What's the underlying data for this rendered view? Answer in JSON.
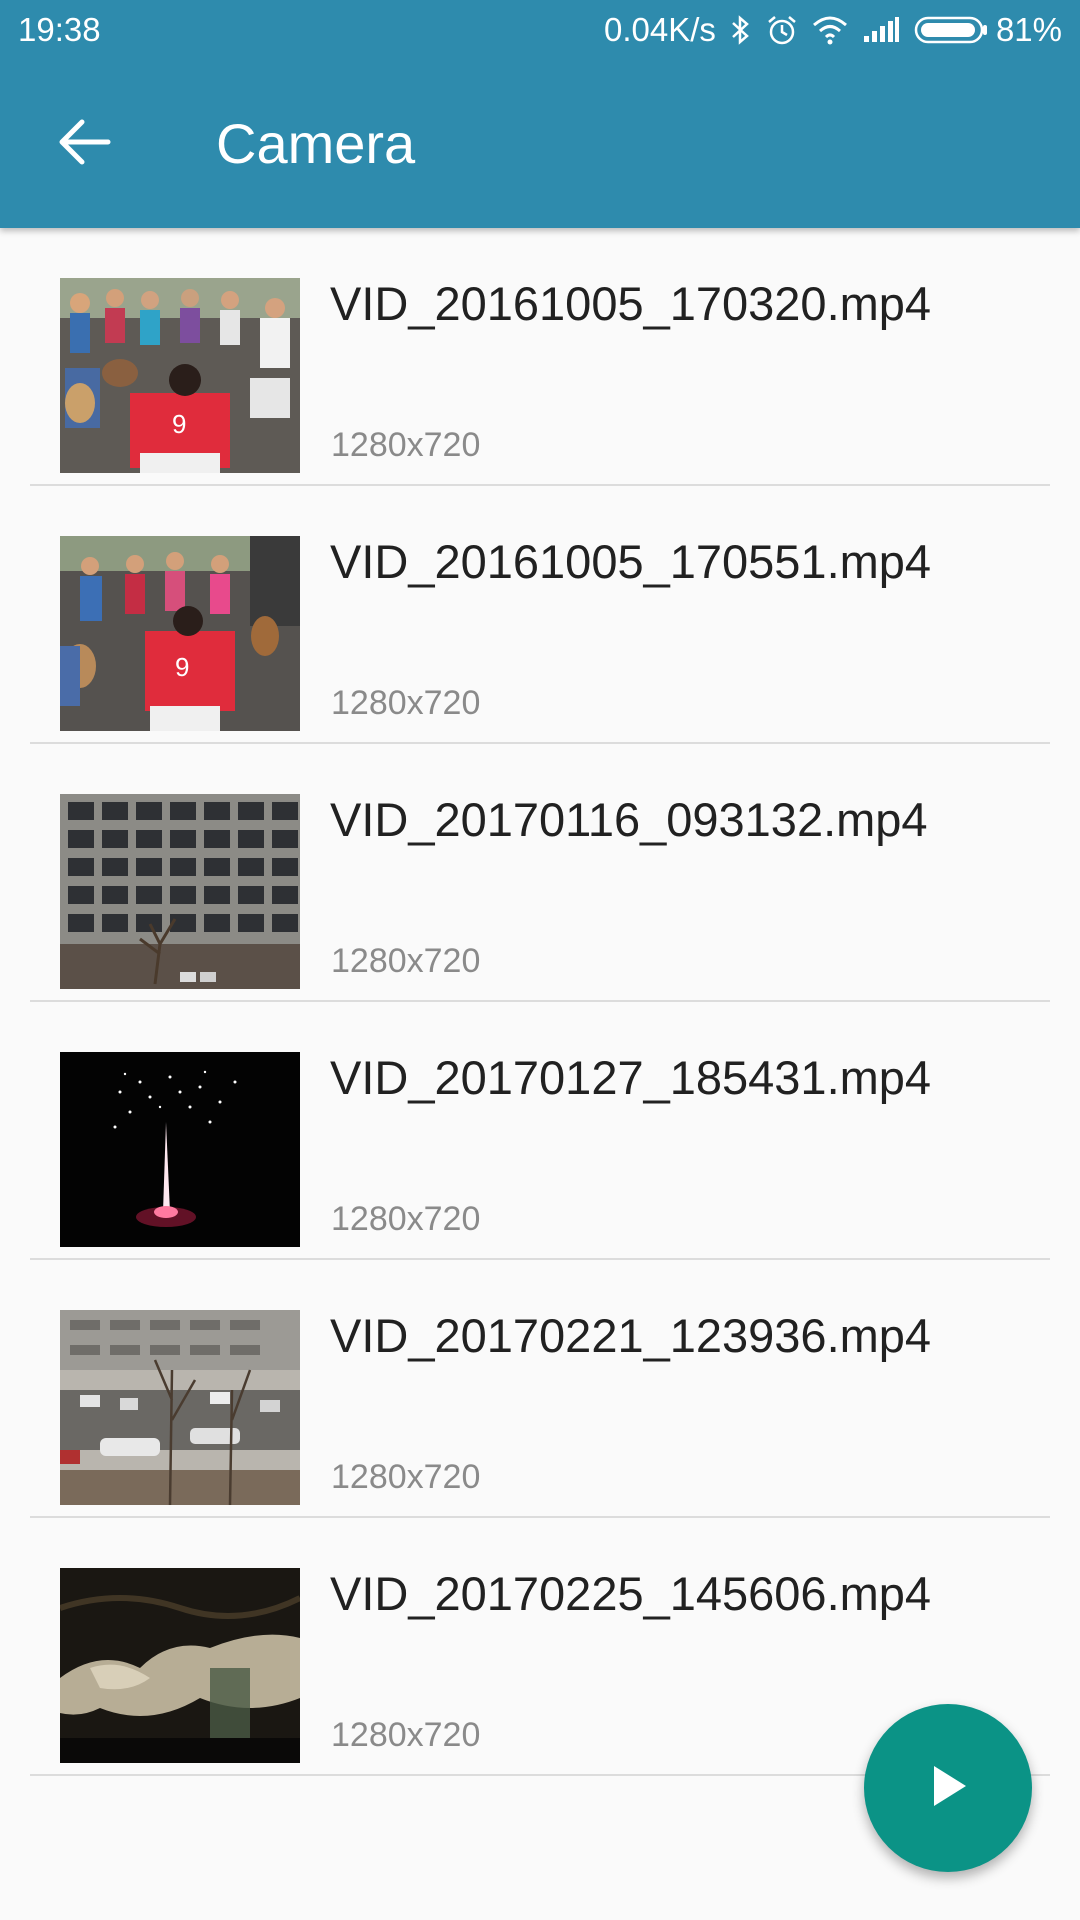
{
  "status_bar": {
    "time": "19:38",
    "network_speed": "0.04K/s",
    "battery_percent": "81%",
    "icons": [
      "bluetooth-icon",
      "alarm-icon",
      "wifi-icon",
      "signal-icon",
      "battery-icon"
    ]
  },
  "app_bar": {
    "title": "Camera",
    "back_icon": "arrow-back-icon"
  },
  "videos": [
    {
      "name": "",
      "resolution": "1280x720",
      "thumbnail": "sand-water"
    },
    {
      "name": "VID_20161005_170320.mp4",
      "resolution": "1280x720",
      "thumbnail": "drum-circle"
    },
    {
      "name": "VID_20161005_170551.mp4",
      "resolution": "1280x720",
      "thumbnail": "drum-circle"
    },
    {
      "name": "VID_20170116_093132.mp4",
      "resolution": "1280x720",
      "thumbnail": "office-building"
    },
    {
      "name": "VID_20170127_185431.mp4",
      "resolution": "1280x720",
      "thumbnail": "fireworks"
    },
    {
      "name": "VID_20170221_123936.mp4",
      "resolution": "1280x720",
      "thumbnail": "street-trees"
    },
    {
      "name": "VID_20170225_145606.mp4",
      "resolution": "1280x720",
      "thumbnail": "dark-water"
    }
  ],
  "fab": {
    "icon": "play-icon"
  },
  "colors": {
    "primary": "#2e8bad",
    "fab": "#0b9386",
    "background": "#fafafa"
  }
}
